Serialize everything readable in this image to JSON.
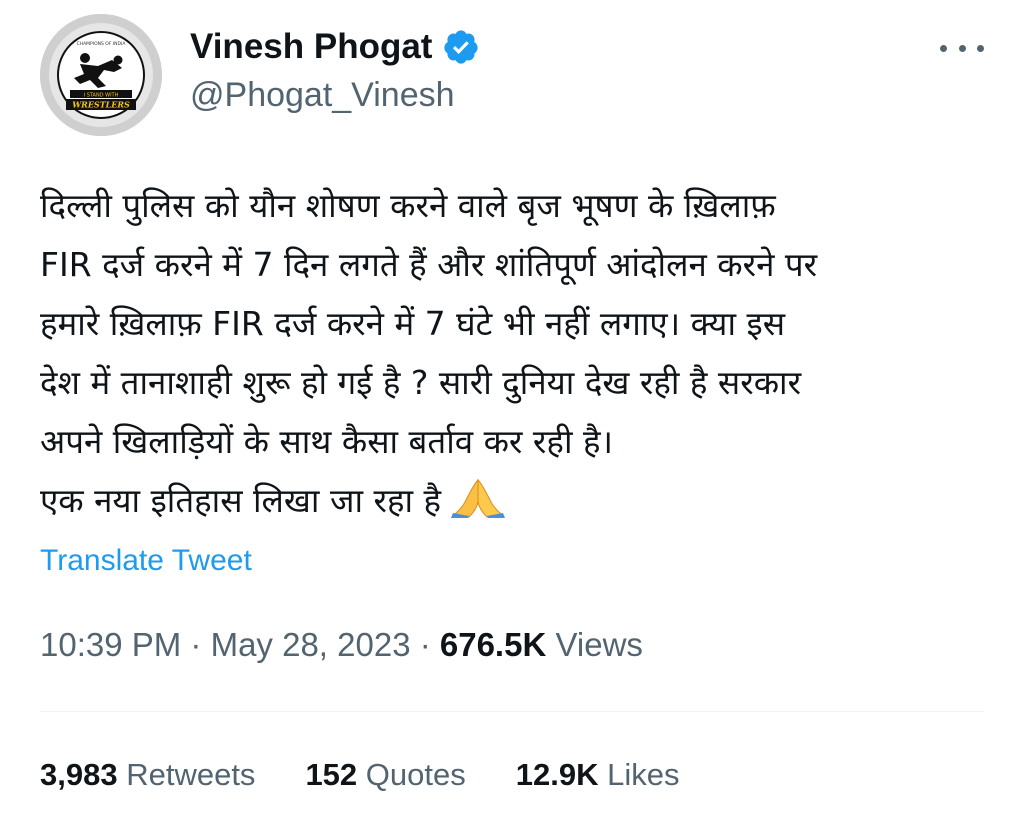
{
  "author": {
    "display_name": "Vinesh Phogat",
    "handle": "@Phogat_Vinesh",
    "verified": true,
    "avatar_text_top": "I STAND WITH",
    "avatar_text_bottom": "WRESTLERS",
    "avatar_ring_text": "CHAMPIONS OF INDIA"
  },
  "tweet": {
    "lines": [
      "दिल्ली पुलिस को यौन शोषण करने वाले बृज भूषण के ख़िलाफ़",
      "FIR दर्ज करने में 7 दिन लगते हैं और शांतिपूर्ण आंदोलन करने पर",
      "हमारे ख़िलाफ़ FIR दर्ज करने में 7 घंटे भी नहीं लगाए। क्या इस",
      "देश में तानाशाही शुरू हो गई है ? सारी दुनिया देख रही है सरकार",
      "अपने खिलाड़ियों के साथ कैसा बर्ताव कर रही है।",
      "एक नया इतिहास लिखा जा रहा है"
    ],
    "emoji": "folded-hands"
  },
  "translate_label": "Translate Tweet",
  "meta": {
    "time": "10:39 PM",
    "separator": " · ",
    "date": "May 28, 2023",
    "views_count": "676.5K",
    "views_label": "Views"
  },
  "stats": {
    "retweets_count": "3,983",
    "retweets_label": "Retweets",
    "quotes_count": "152",
    "quotes_label": "Quotes",
    "likes_count": "12.9K",
    "likes_label": "Likes"
  },
  "colors": {
    "text_primary": "#0f1419",
    "text_secondary": "#536471",
    "link": "#1d9bf0",
    "verified_badge": "#1d9bf0"
  },
  "icons": {
    "more": "more-horizontal-icon",
    "verified": "verified-badge-icon"
  }
}
